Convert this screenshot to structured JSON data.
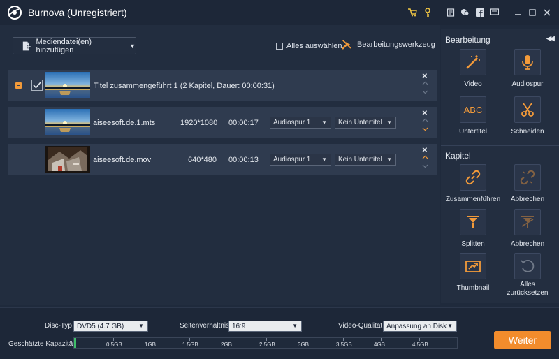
{
  "window": {
    "title": "Burnova (Unregistriert)",
    "icons": [
      "cart-icon",
      "key-icon",
      "register-icon",
      "feedback-icon",
      "facebook-icon",
      "chat-icon",
      "minimize-icon",
      "maximize-icon",
      "close-icon"
    ]
  },
  "toolbar": {
    "add_media_label": "Mediendatei(en) hinzufügen",
    "select_all_label": "Alles auswählen",
    "edit_tool_label": "Bearbeitungswerkzeug"
  },
  "titles": [
    {
      "label": "Titel zusammengeführt 1 (2 Kapitel, Dauer: 00:00:31)",
      "files": [
        {
          "name": "aiseesoft.de.1.mts",
          "resolution": "1920*1080",
          "duration": "00:00:17",
          "audio": "Audiospur 1",
          "subtitle": "Kein Untertitel"
        },
        {
          "name": "aiseesoft.de.mov",
          "resolution": "640*480",
          "duration": "00:00:13",
          "audio": "Audiospur 1",
          "subtitle": "Kein Untertitel"
        }
      ]
    }
  ],
  "sidebar": {
    "edit_heading": "Bearbeitung",
    "edit_tools": [
      {
        "label": "Video",
        "icon": "magic-wand-icon"
      },
      {
        "label": "Audiospur",
        "icon": "microphone-icon"
      },
      {
        "label": "Untertitel",
        "icon": "abc-icon",
        "glyph": "ABC"
      },
      {
        "label": "Schneiden",
        "icon": "scissors-icon"
      }
    ],
    "chapter_heading": "Kapitel",
    "chapter_tools": [
      {
        "label": "Zusammenführen",
        "icon": "link-icon"
      },
      {
        "label": "Abbrechen",
        "icon": "unlink-icon"
      },
      {
        "label": "Splitten",
        "icon": "split-icon"
      },
      {
        "label": "Abbrechen",
        "icon": "cancel-split-icon"
      },
      {
        "label": "Thumbnail",
        "icon": "thumbnail-icon"
      },
      {
        "label": "Alles zurücksetzen",
        "icon": "reset-icon"
      }
    ]
  },
  "bottom": {
    "disc_type_label": "Disc-Typ",
    "disc_type_value": "DVD5 (4.7 GB)",
    "aspect_label": "Seitenverhältnis:",
    "aspect_value": "16:9",
    "quality_label": "Video-Qualität:",
    "quality_value": "Anpassung an Disk",
    "capacity_label": "Geschätzte Kapazität:",
    "capacity_ticks": [
      "0.5GB",
      "1GB",
      "1.5GB",
      "2GB",
      "2.5GB",
      "3GB",
      "3.5GB",
      "4GB",
      "4.5GB"
    ],
    "capacity_used_fraction": 0.005,
    "next_button": "Weiter"
  },
  "colors": {
    "accent": "#f28c2c",
    "capacity": "#3fbf6a",
    "background": "#1f2a3c"
  }
}
